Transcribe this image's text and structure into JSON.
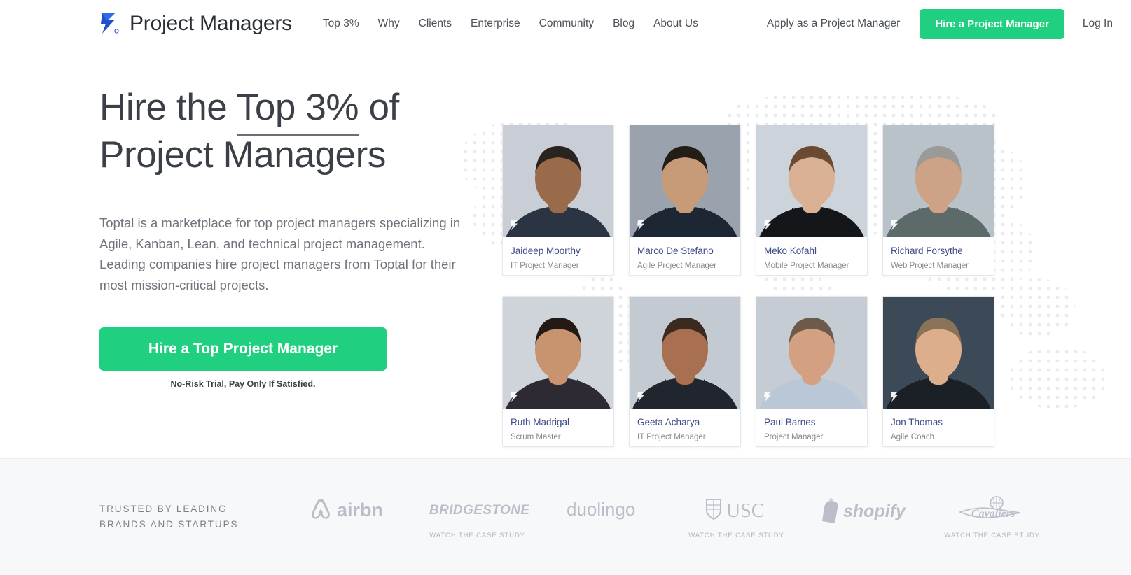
{
  "header": {
    "brand_name": "Project Managers",
    "logo_icon": "toptal-logo-icon",
    "nav_items": [
      {
        "label": "Top 3%"
      },
      {
        "label": "Why"
      },
      {
        "label": "Clients"
      },
      {
        "label": "Enterprise"
      },
      {
        "label": "Community"
      },
      {
        "label": "Blog"
      },
      {
        "label": "About Us"
      }
    ],
    "apply_label": "Apply as a Project Manager",
    "hire_button_label": "Hire a Project Manager",
    "login_label": "Log In",
    "accent_color": "#20cf80"
  },
  "hero": {
    "headline_pre": "Hire the ",
    "headline_accent": "Top 3%",
    "headline_post": " of",
    "headline_line2": "Project Managers",
    "paragraph1": "Toptal is a marketplace for top project managers specializing in Agile, Kanban, Lean, and technical project management.",
    "paragraph2": "Leading companies hire project managers from Toptal for their most mission-critical projects.",
    "cta_label": "Hire a Top Project Manager",
    "cta_note": "No-Risk Trial, Pay Only If Satisfied."
  },
  "talent": [
    {
      "name": "Jaideep Moorthy",
      "role": "IT Project Manager",
      "skin": "#9a6b4a",
      "hair": "#2a2420",
      "shirt": "#2b3442",
      "bg": "#c9ced6"
    },
    {
      "name": "Marco De Stefano",
      "role": "Agile Project Manager",
      "skin": "#c79a78",
      "hair": "#241c17",
      "shirt": "#1d2733",
      "bg": "#9aa3ad"
    },
    {
      "name": "Meko Kofahl",
      "role": "Mobile Project Manager",
      "skin": "#d9b093",
      "hair": "#6b4a33",
      "shirt": "#141619",
      "bg": "#cdd3da"
    },
    {
      "name": "Richard Forsythe",
      "role": "Web Project Manager",
      "skin": "#cda287",
      "hair": "#9a9a96",
      "shirt": "#5c6b6a",
      "bg": "#b9c2c9"
    },
    {
      "name": "Ruth Madrigal",
      "role": "Scrum Master",
      "skin": "#c89470",
      "hair": "#231a15",
      "shirt": "#2d2a33",
      "bg": "#cfd4da"
    },
    {
      "name": "Geeta Acharya",
      "role": "IT Project Manager",
      "skin": "#a87050",
      "hair": "#3a2a20",
      "shirt": "#20252e",
      "bg": "#c3cad2"
    },
    {
      "name": "Paul Barnes",
      "role": "Project Manager",
      "skin": "#d3a181",
      "hair": "#6d5a4a",
      "shirt": "#b9c7d6",
      "bg": "#c6ccd3"
    },
    {
      "name": "Jon Thomas",
      "role": "Agile Coach",
      "skin": "#dcae8c",
      "hair": "#8a7358",
      "shirt": "#1b2027",
      "bg": "#3c4a58"
    }
  ],
  "trusted": {
    "label_line1": "Trusted by leading",
    "label_line2": "brands and startups",
    "case_study_label": "Watch the case study",
    "logos": [
      {
        "name": "airbnb",
        "text": "airbnb",
        "has_case_study": false
      },
      {
        "name": "bridgestone",
        "text": "BRIDGESTONE",
        "has_case_study": true
      },
      {
        "name": "duolingo",
        "text": "duolingo",
        "has_case_study": false
      },
      {
        "name": "usc",
        "text": "USC",
        "has_case_study": true
      },
      {
        "name": "shopify",
        "text": "shopify",
        "has_case_study": false
      },
      {
        "name": "cavaliers",
        "text": "Cavaliers",
        "has_case_study": true
      }
    ]
  }
}
